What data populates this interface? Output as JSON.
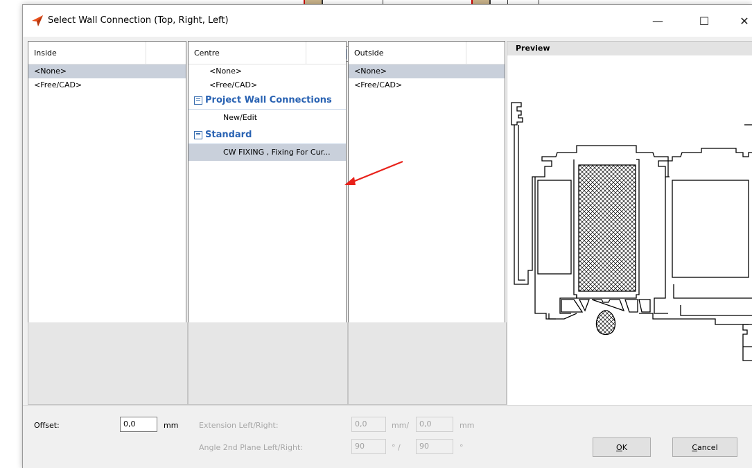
{
  "window": {
    "title": "Select Wall Connection (Top, Right, Left)",
    "minimize_glyph": "—",
    "maximize_glyph": "☐",
    "close_glyph": "✕"
  },
  "columns": {
    "inside": {
      "header": "Inside",
      "combo_value": "",
      "rows": [
        {
          "label": "<None>",
          "selected": true
        },
        {
          "label": "<Free/CAD>",
          "selected": false
        }
      ]
    },
    "centre": {
      "header": "Centre",
      "combo_value": "",
      "rows": [
        {
          "label": "<None>"
        },
        {
          "label": "<Free/CAD>"
        }
      ],
      "groups": [
        {
          "label": "Project Wall Connections",
          "items": [
            "New/Edit"
          ]
        },
        {
          "label": "Standard",
          "items": [
            "CW FIXING , Fixing For Cur..."
          ]
        }
      ]
    },
    "outside": {
      "header": "Outside",
      "combo_value": "",
      "rows": [
        {
          "label": "<None>",
          "selected": true
        },
        {
          "label": "<Free/CAD>",
          "selected": false
        }
      ]
    }
  },
  "preview": {
    "title": "Preview"
  },
  "bottom": {
    "offset_label": "Offset:",
    "offset_value": "0,0",
    "offset_unit": "mm",
    "extension_label": "Extension Left/Right:",
    "extension_left": "0,0",
    "extension_sep": "mm/",
    "extension_right": "0,0",
    "extension_unit": "mm",
    "angle_label": "Angle 2nd Plane Left/Right:",
    "angle_left": "90",
    "angle_sep": "° /",
    "angle_right": "90",
    "angle_unit": "°",
    "ok_prefix": "",
    "ok_underline": "O",
    "ok_rest": "K",
    "cancel_underline": "C",
    "cancel_rest": "ancel"
  },
  "colors": {
    "accent_blue": "#2a63b3",
    "selection": "#c9d0db",
    "arrow_red": "#e8211a"
  }
}
